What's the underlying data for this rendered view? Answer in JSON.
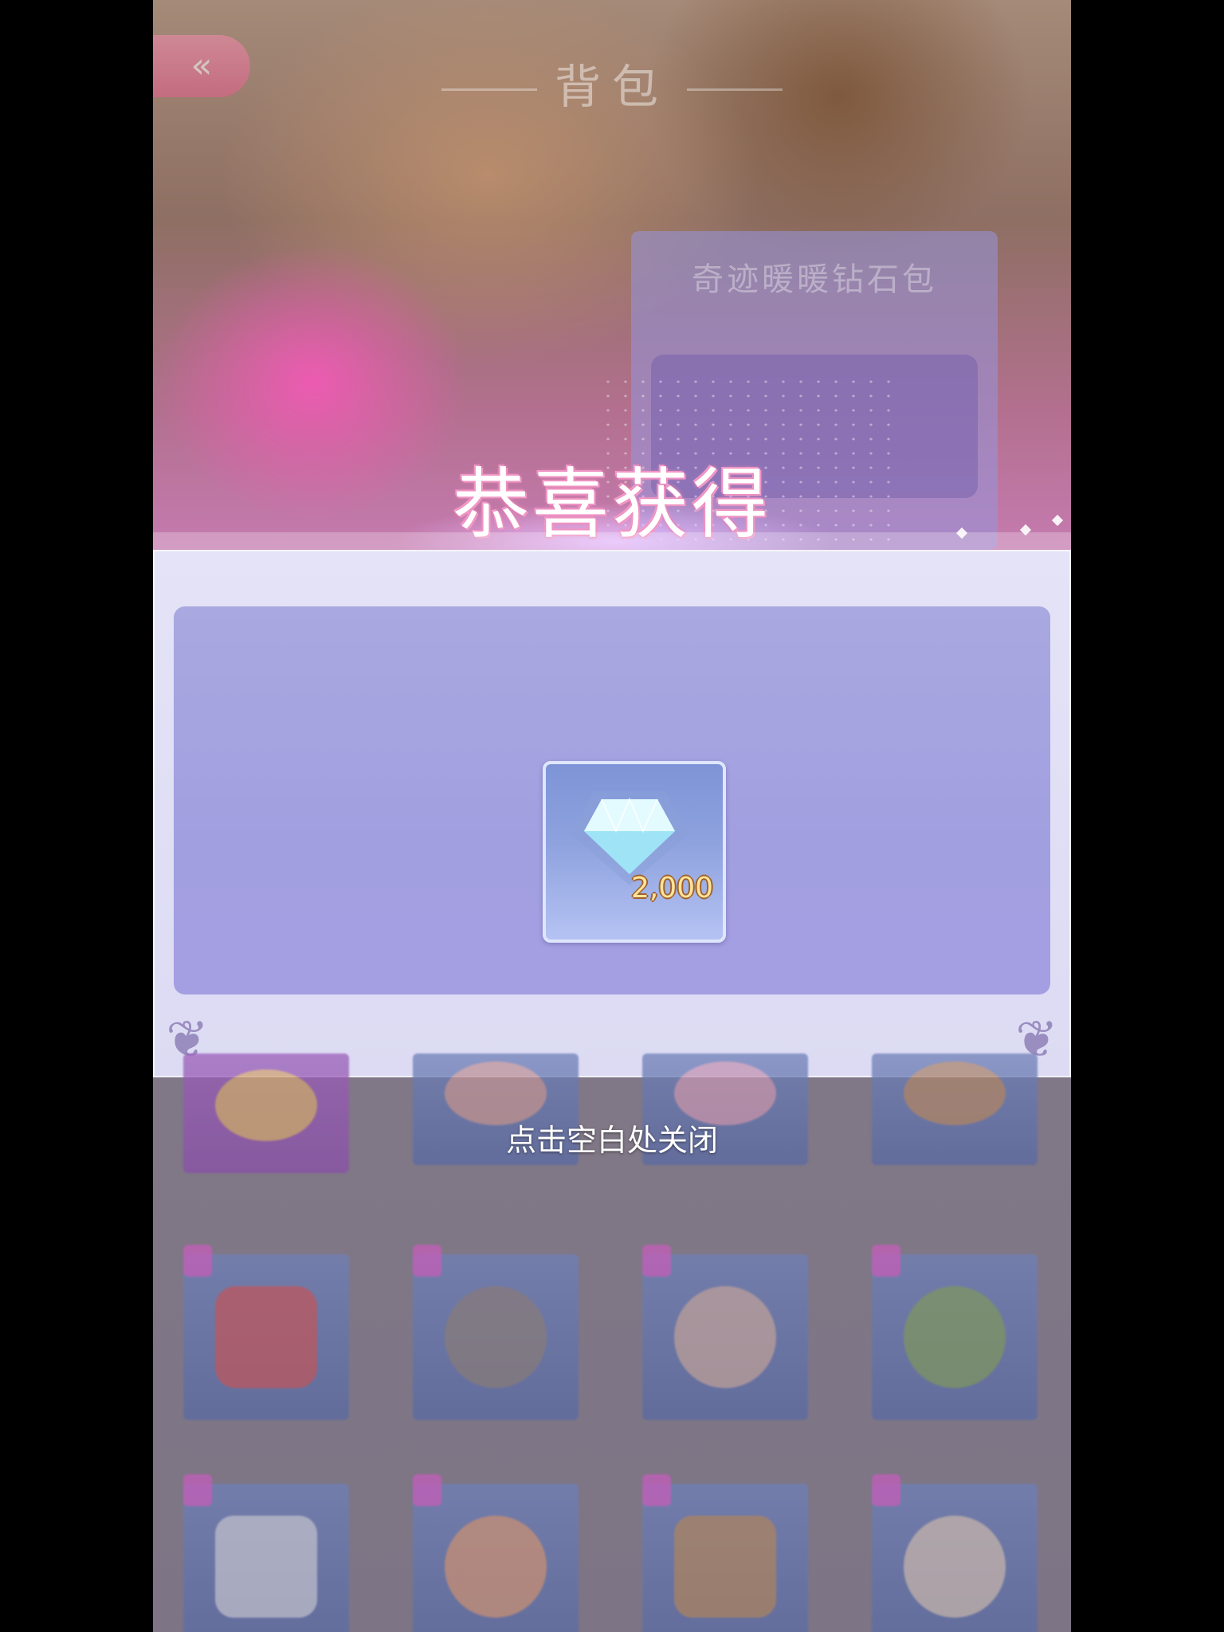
{
  "header": {
    "back_icon": "double-chevron-left-icon",
    "title": "背包"
  },
  "background_card": {
    "title": "奇迹暖暖钻石包"
  },
  "popup": {
    "title": "恭喜获得",
    "reward": {
      "icon": "diamond-icon",
      "quantity": "2,000"
    },
    "close_hint": "点击空白处关闭"
  },
  "colors": {
    "title_glow": "#f08fc0",
    "panel_bg": "#e4e3f7",
    "panel_inner": "#a29fe0",
    "quantity_text": "#ffe39a"
  }
}
